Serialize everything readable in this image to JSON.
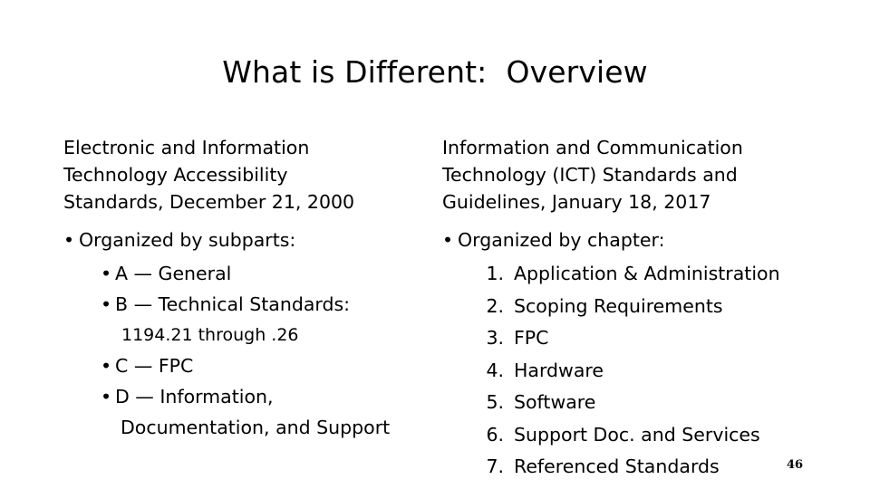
{
  "slide": {
    "title": "What is Different:  Overview",
    "page_number": "46",
    "bullet_glyph": "•"
  },
  "left_column": {
    "heading_lines": [
      "Electronic and Information",
      "Technology Accessibility",
      "Standards, December 21, 2000"
    ],
    "lead_bullet": "Organized by subparts:",
    "items": [
      {
        "text": "A — General",
        "type": "bullet"
      },
      {
        "text": "B — Technical Standards:",
        "type": "bullet"
      },
      {
        "text": "1194.21 through .26",
        "type": "plain"
      },
      {
        "text": "C — FPC",
        "type": "bullet"
      },
      {
        "text": "D — Information,",
        "wrap": "Documentation, and Support",
        "type": "bullet"
      }
    ]
  },
  "right_column": {
    "heading_lines": [
      "Information and Communication",
      "Technology (ICT) Standards and",
      "Guidelines, January 18, 2017"
    ],
    "lead_bullet": "Organized by chapter:",
    "items": [
      {
        "number": "1.",
        "text": "Application & Administration"
      },
      {
        "number": "2.",
        "text": "Scoping Requirements"
      },
      {
        "number": "3.",
        "text": "FPC"
      },
      {
        "number": "4.",
        "text": "Hardware"
      },
      {
        "number": "5.",
        "text": "Software"
      },
      {
        "number": "6.",
        "text": "Support Doc. and Services"
      },
      {
        "number": "7.",
        "text": "Referenced Standards"
      }
    ]
  },
  "colors": {
    "background": "#ffffff",
    "text": "#000000"
  }
}
